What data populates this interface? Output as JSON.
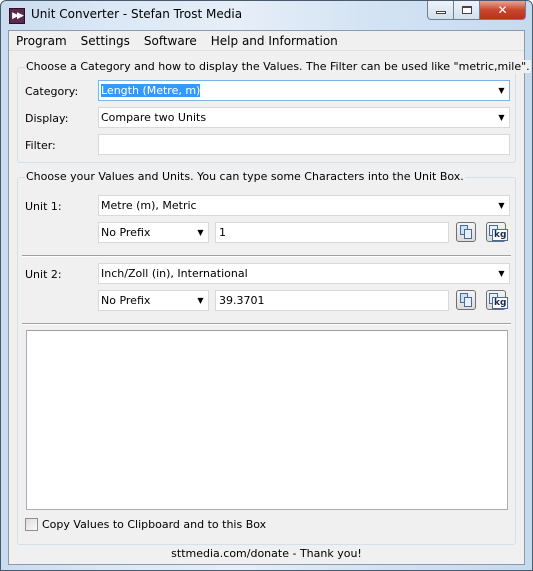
{
  "window": {
    "title": "Unit Converter - Stefan Trost Media",
    "app_icon": "double-chevron-right-icon",
    "controls": {
      "minimize": "minimize-icon",
      "maximize": "maximize-icon",
      "close": "close-icon"
    }
  },
  "menu": {
    "items": [
      {
        "label": "Program"
      },
      {
        "label": "Settings"
      },
      {
        "label": "Software"
      },
      {
        "label": "Help and Information"
      }
    ]
  },
  "category_group": {
    "legend": "Choose a Category and how to display the Values. The Filter can be used like \"metric,mile\".",
    "category_label": "Category:",
    "category_value": "Length (Metre, m)",
    "display_label": "Display:",
    "display_value": "Compare two Units",
    "filter_label": "Filter:",
    "filter_value": ""
  },
  "values_group": {
    "legend": "Choose your Values and Units. You can type some Characters into the Unit Box.",
    "unit1": {
      "label": "Unit 1:",
      "unit_value": "Metre (m), Metric",
      "prefix_value": "No Prefix",
      "amount": "1"
    },
    "unit2": {
      "label": "Unit 2:",
      "unit_value": "Inch/Zoll (in), International",
      "prefix_value": "No Prefix",
      "amount": "39.3701"
    },
    "output_box": "",
    "copy_checkbox_label": "Copy Values to Clipboard and to this Box",
    "copy_checkbox_checked": false
  },
  "footer": {
    "text": "sttmedia.com/donate - Thank you!"
  }
}
